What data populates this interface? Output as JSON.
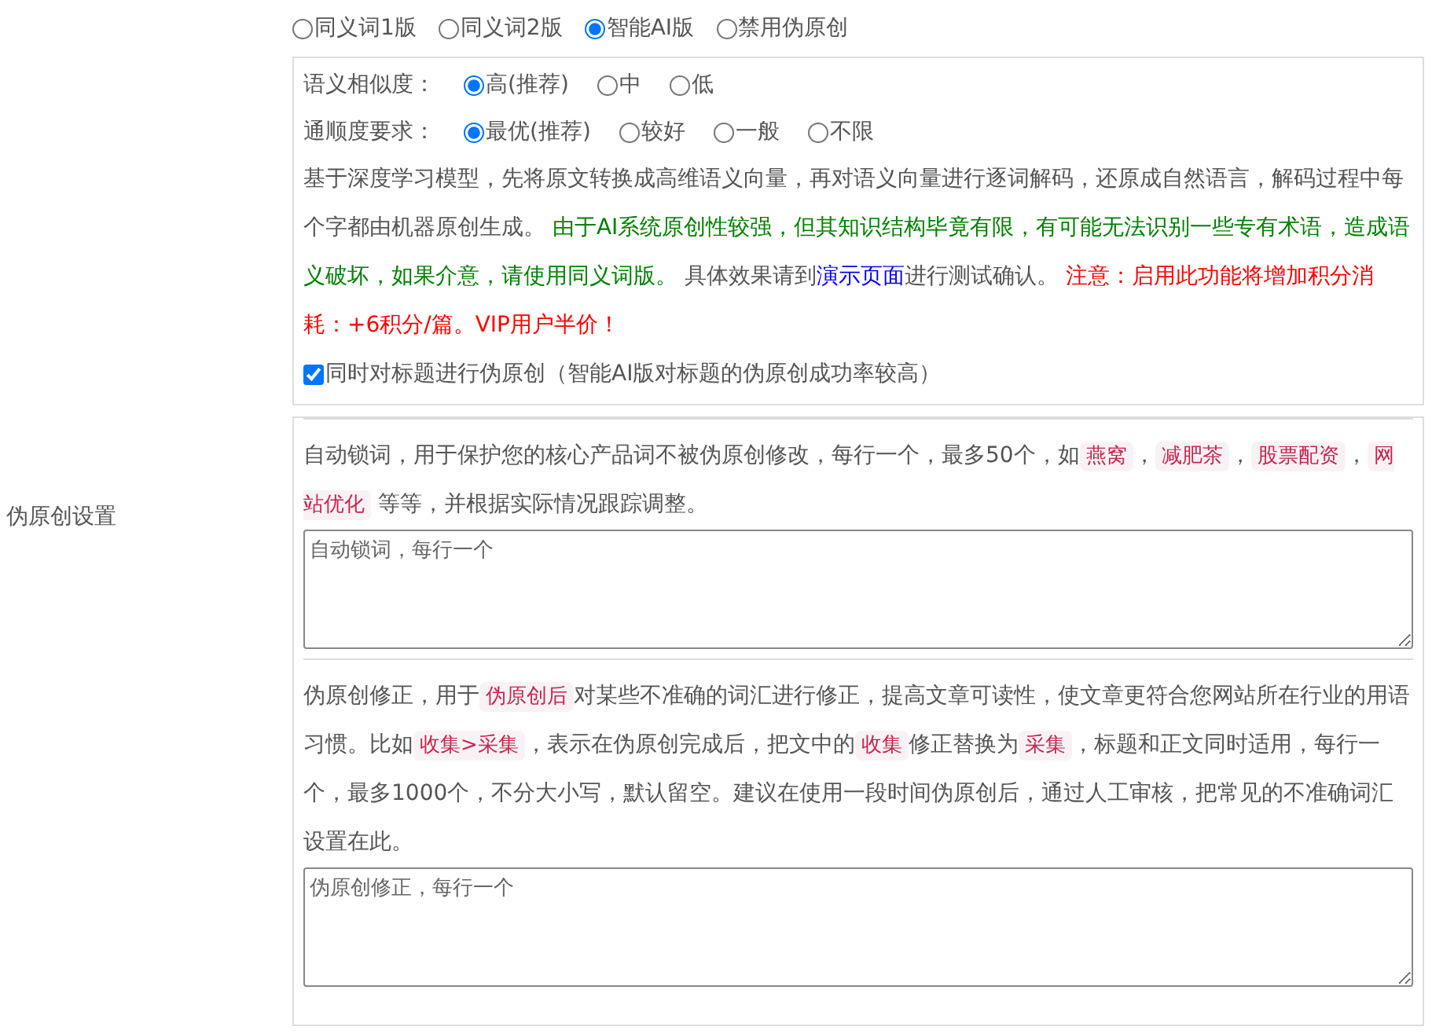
{
  "sidebar_label": "伪原创设置",
  "mode_options": [
    {
      "label": "同义词1版",
      "selected": false
    },
    {
      "label": "同义词2版",
      "selected": false
    },
    {
      "label": "智能AI版",
      "selected": true
    },
    {
      "label": "禁用伪原创",
      "selected": false
    }
  ],
  "ai_settings": {
    "similarity": {
      "label": "语义相似度：",
      "options": [
        {
          "label": "高(推荐)",
          "selected": true
        },
        {
          "label": "中",
          "selected": false
        },
        {
          "label": "低",
          "selected": false
        }
      ]
    },
    "fluency": {
      "label": "通顺度要求：",
      "options": [
        {
          "label": "最优(推荐)",
          "selected": true
        },
        {
          "label": "较好",
          "selected": false
        },
        {
          "label": "一般",
          "selected": false
        },
        {
          "label": "不限",
          "selected": false
        }
      ]
    },
    "description": [
      {
        "kind": "plain",
        "text": "基于深度学习模型，先将原文转换成高维语义向量，再对语义向量进行逐词解码，还原成自然语言，解码过程中每个字都由机器原创生成。 "
      },
      {
        "kind": "green",
        "text": "由于AI系统原创性较强，但其知识结构毕竟有限，有可能无法识别一些专有术语，造成语义破坏，如果介意，请使用同义词版。"
      },
      {
        "kind": "plain",
        "text": " 具体效果请到"
      },
      {
        "kind": "link",
        "text": "演示页面"
      },
      {
        "kind": "plain",
        "text": "进行测试确认。 "
      },
      {
        "kind": "red",
        "text": "注意：启用此功能将增加积分消耗：+6积分/篇。VIP用户半价！"
      }
    ],
    "title_checkbox": {
      "label": "同时对标题进行伪原创（智能AI版对标题的伪原创成功率较高）",
      "checked": true
    }
  },
  "lock_words": {
    "description": [
      {
        "kind": "plain",
        "text": "自动锁词，用于保护您的核心产品词不被伪原创修改，每行一个，最多50个，如"
      },
      {
        "kind": "code",
        "text": "燕窝"
      },
      {
        "kind": "plain",
        "text": "，"
      },
      {
        "kind": "code",
        "text": "减肥茶"
      },
      {
        "kind": "plain",
        "text": "，"
      },
      {
        "kind": "code",
        "text": "股票配资"
      },
      {
        "kind": "plain",
        "text": "，"
      },
      {
        "kind": "code",
        "text": "网站优化"
      },
      {
        "kind": "plain",
        "text": " 等等，并根据实际情况跟踪调整。"
      }
    ],
    "placeholder": "自动锁词，每行一个"
  },
  "correction": {
    "description": [
      {
        "kind": "plain",
        "text": "伪原创修正，用于"
      },
      {
        "kind": "code",
        "text": "伪原创后"
      },
      {
        "kind": "plain",
        "text": "对某些不准确的词汇进行修正，提高文章可读性，使文章更符合您网站所在行业的用语习惯。比如"
      },
      {
        "kind": "code",
        "text": "收集>采集"
      },
      {
        "kind": "plain",
        "text": "，表示在伪原创完成后，把文中的"
      },
      {
        "kind": "code",
        "text": "收集"
      },
      {
        "kind": "plain",
        "text": "修正替换为"
      },
      {
        "kind": "code",
        "text": "采集"
      },
      {
        "kind": "plain",
        "text": "，标题和正文同时适用，每行一个，最多1000个，不分大小写，默认留空。建议在使用一段时间伪原创后，通过人工审核，把常见的不准确词汇设置在此。"
      }
    ],
    "placeholder": "伪原创修正，每行一个"
  }
}
